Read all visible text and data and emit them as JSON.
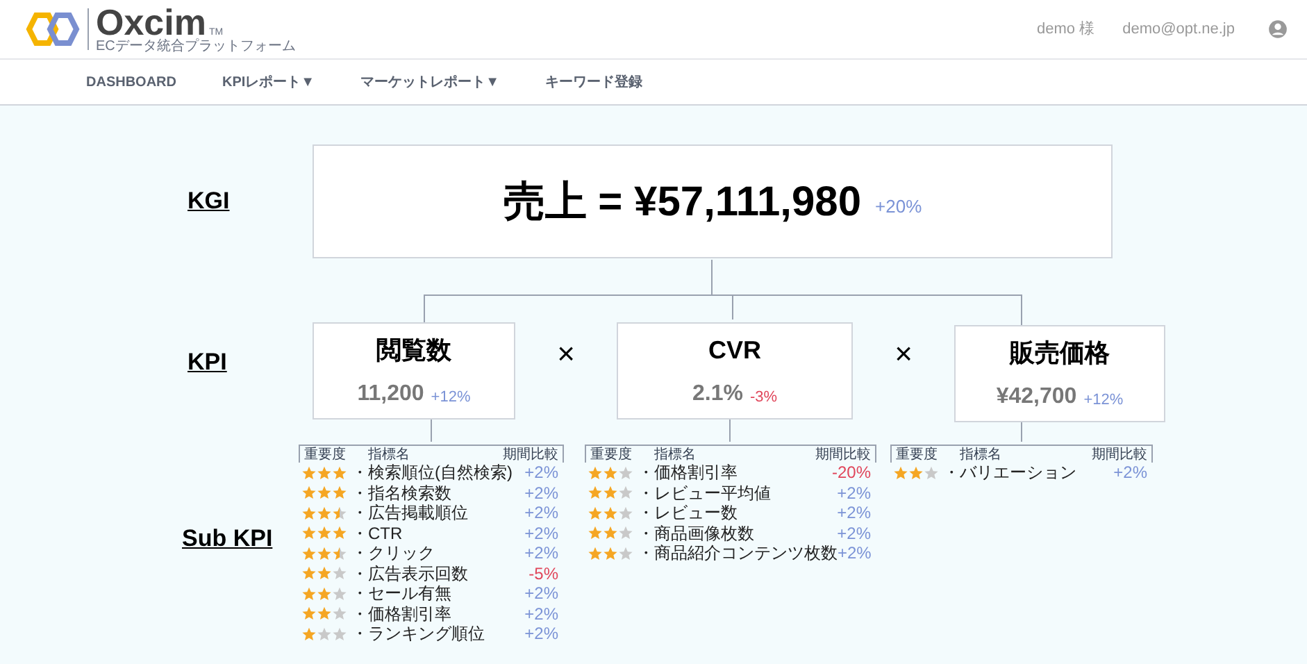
{
  "header": {
    "brand": "Oxcim",
    "trademark": "TM",
    "tagline": "ECデータ統合プラットフォーム",
    "user_name": "demo 様",
    "user_email": "demo@opt.ne.jp"
  },
  "nav": [
    {
      "label": "DASHBOARD"
    },
    {
      "label": "KPIレポート▼"
    },
    {
      "label": "マーケットレポート▼"
    },
    {
      "label": "キーワード登録"
    }
  ],
  "labels": {
    "kgi": "KGI",
    "kpi": "KPI",
    "sub_kpi": "Sub KPI"
  },
  "kgi": {
    "formula": "売上 = ¥57,111,980",
    "change": "+20%",
    "color": "#7b93d6"
  },
  "operators": [
    "×",
    "×"
  ],
  "kpis": [
    {
      "title": "閲覧数",
      "value": "11,200",
      "change": "+12%",
      "color": "#7b93d6"
    },
    {
      "title": "CVR",
      "value": "2.1%",
      "change": "-3%",
      "color": "#e0455a"
    },
    {
      "title": "販売価格",
      "value": "¥42,700",
      "change": "+12%",
      "color": "#7b93d6"
    }
  ],
  "sub_kpi_tables": [
    {
      "columns": [
        "重要度",
        "指標名",
        "期間比較"
      ],
      "rows": [
        {
          "stars": 3,
          "name": "・検索順位(自然検索)",
          "change": "+2%",
          "color": "#7b93d6"
        },
        {
          "stars": 3,
          "name": "・指名検索数",
          "change": "+2%",
          "color": "#7b93d6"
        },
        {
          "stars": 2.5,
          "name": "・広告掲載順位",
          "change": "+2%",
          "color": "#7b93d6"
        },
        {
          "stars": 3,
          "name": "・CTR",
          "change": "+2%",
          "color": "#7b93d6"
        },
        {
          "stars": 2.5,
          "name": "・クリック",
          "change": "+2%",
          "color": "#7b93d6"
        },
        {
          "stars": 2,
          "name": "・広告表示回数",
          "change": "-5%",
          "color": "#e0455a"
        },
        {
          "stars": 2,
          "name": "・セール有無",
          "change": "+2%",
          "color": "#7b93d6"
        },
        {
          "stars": 2,
          "name": "・価格割引率",
          "change": "+2%",
          "color": "#7b93d6"
        },
        {
          "stars": 1,
          "name": "・ランキング順位",
          "change": "+2%",
          "color": "#7b93d6"
        }
      ]
    },
    {
      "columns": [
        "重要度",
        "指標名",
        "期間比較"
      ],
      "rows": [
        {
          "stars": 2,
          "name": "・価格割引率",
          "change": "-20%",
          "color": "#e0455a"
        },
        {
          "stars": 2,
          "name": "・レビュー平均値",
          "change": "+2%",
          "color": "#7b93d6"
        },
        {
          "stars": 2,
          "name": "・レビュー数",
          "change": "+2%",
          "color": "#7b93d6"
        },
        {
          "stars": 2,
          "name": "・商品画像枚数",
          "change": "+2%",
          "color": "#7b93d6"
        },
        {
          "stars": 2,
          "name": "・商品紹介コンテンツ枚数",
          "change": "+2%",
          "color": "#7b93d6"
        }
      ]
    },
    {
      "columns": [
        "重要度",
        "指標名",
        "期間比較"
      ],
      "rows": [
        {
          "stars": 2,
          "name": "・バリエーション",
          "change": "+2%",
          "color": "#7b93d6"
        }
      ]
    }
  ]
}
